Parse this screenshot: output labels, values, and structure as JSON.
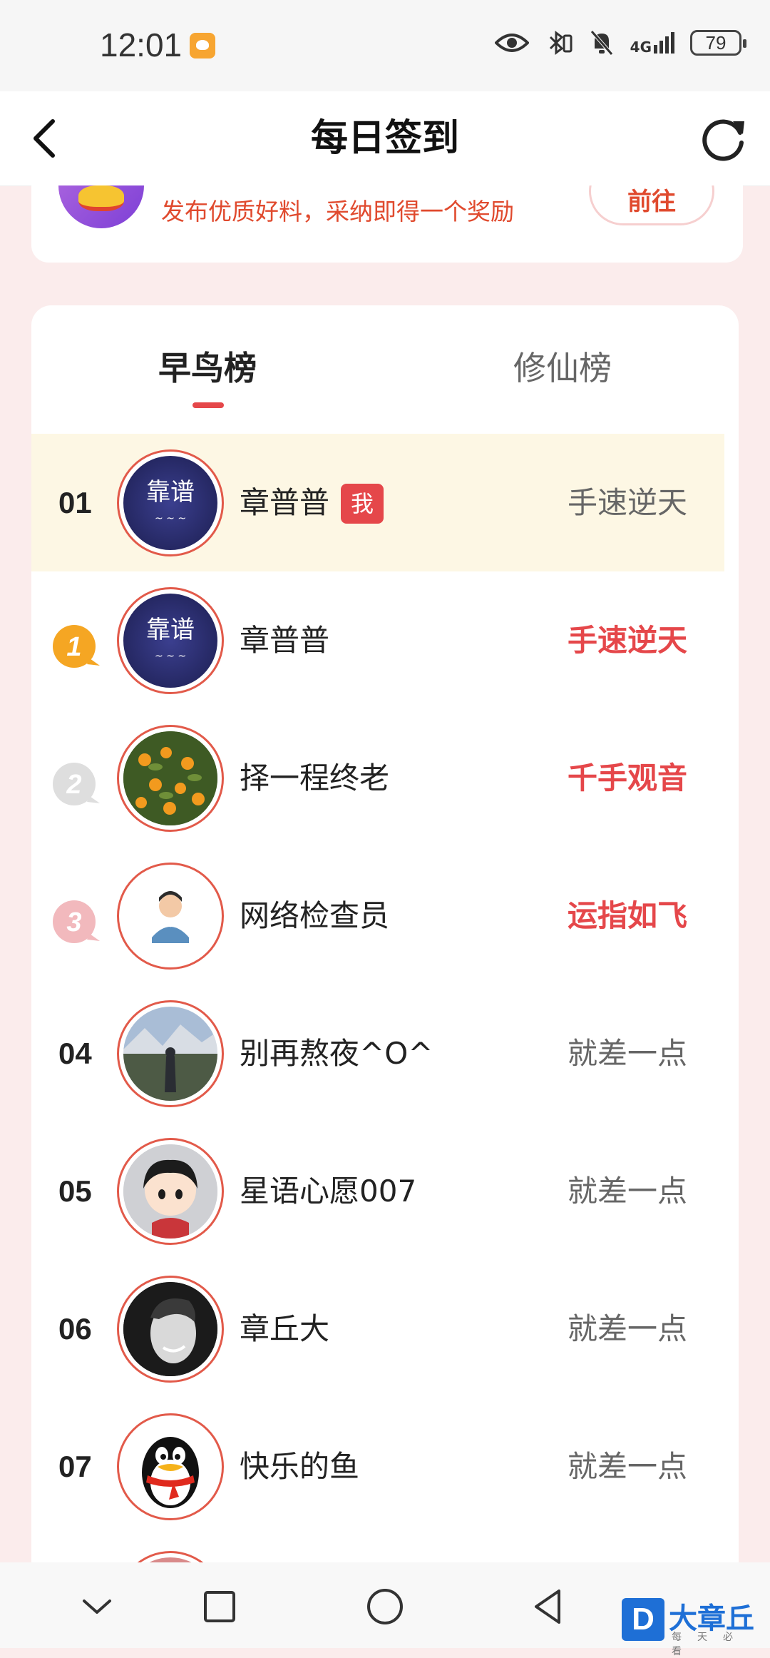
{
  "status_bar": {
    "time": "12:01",
    "network": "4G",
    "battery": "79"
  },
  "header": {
    "title": "每日签到"
  },
  "promo": {
    "text": "发布优质好料，采纳即得一个奖励",
    "button_label": "前往"
  },
  "tabs": [
    {
      "label": "早鸟榜",
      "active": true
    },
    {
      "label": "修仙榜",
      "active": false
    }
  ],
  "me_badge": "我",
  "rows": [
    {
      "rank": "01",
      "name": "章普普",
      "tag": "手速逆天",
      "mine": true
    },
    {
      "rank": "",
      "medal": "gold-medal-1",
      "name": "章普普",
      "tag": "手速逆天"
    },
    {
      "rank": "",
      "medal": "silver-medal-2",
      "name": "择一程终老",
      "tag": "千手观音"
    },
    {
      "rank": "",
      "medal": "bronze-medal-3",
      "name": "网络检查员",
      "tag": "运指如飞"
    },
    {
      "rank": "04",
      "name": "别再熬夜^O^",
      "tag": "就差一点"
    },
    {
      "rank": "05",
      "name": "星语心愿007",
      "tag": "就差一点"
    },
    {
      "rank": "06",
      "name": "章丘大",
      "tag": "就差一点"
    },
    {
      "rank": "07",
      "name": "快乐的鱼",
      "tag": "就差一点"
    }
  ],
  "watermark": {
    "letter": "D",
    "text": "大章丘",
    "sub": "每天必看"
  },
  "colors": {
    "accent": "#e5474a",
    "highlight_row": "#fdf7e4",
    "gold": "#f5a623"
  }
}
